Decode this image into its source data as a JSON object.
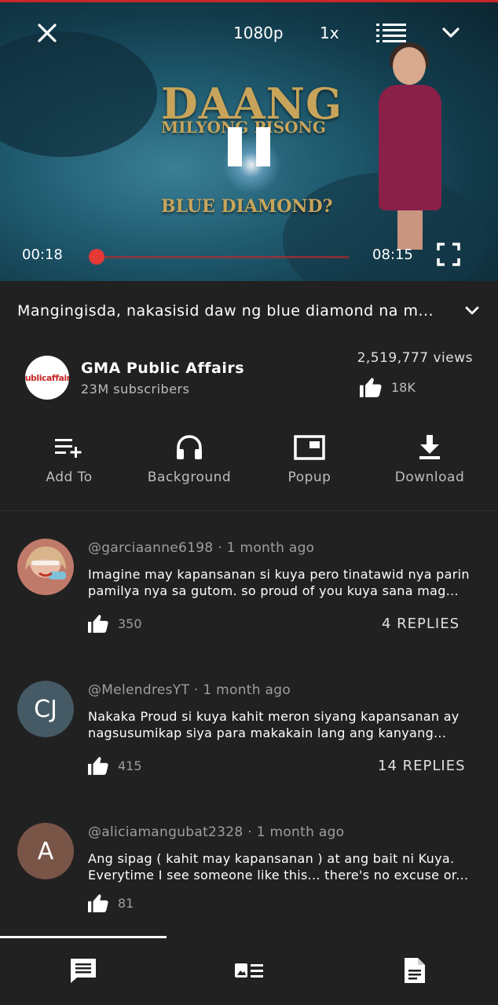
{
  "player": {
    "quality": "1080p",
    "speed": "1x",
    "current_time": "00:18",
    "duration": "08:15",
    "progress": 0.036,
    "overlay_title": "DAANG",
    "overlay_subtitle": "MILYONG PISONG",
    "overlay_bottom": "BLUE DIAMOND?"
  },
  "video": {
    "title": "Mangingisda, nakasisid daw ng blue diamond na m...",
    "views": "2,519,777 views",
    "likes": "18K"
  },
  "channel": {
    "name": "GMA Public  Affairs",
    "subscribers": "23M subscribers",
    "logo_text": "publicaffairs"
  },
  "actions": {
    "add_to": "Add To",
    "background": "Background",
    "popup": "Popup",
    "download": "Download"
  },
  "comments": [
    {
      "author": "@garciaanne6198",
      "time": "1 month ago",
      "line1": "Imagine may kapansanan si kuya pero tinatawid nya parin",
      "line2": "pamilya nya sa gutom. so proud of you kuya sana mag...",
      "likes": "350",
      "replies": "4 REPLIES",
      "avatar_text": "",
      "avatar_color": "#c9a08a"
    },
    {
      "author": "@MelendresYT",
      "time": "1 month ago",
      "line1": "Nakaka Proud si kuya kahit meron siyang kapansanan ay",
      "line2": "nagsusumikap siya para makakain lang ang kanyang...",
      "likes": "415",
      "replies": "14 REPLIES",
      "avatar_text": "CJ",
      "avatar_color": "#455a64"
    },
    {
      "author": "@aliciamangubat2328",
      "time": "1 month ago",
      "line1": "Ang sipag ( kahit may kapansanan )  at ang  bait ni Kuya.",
      "line2": "Everytime I see someone like this... there's no excuse or...",
      "likes": "81",
      "replies": "",
      "avatar_text": "A",
      "avatar_color": "#795548"
    }
  ],
  "colors": {
    "background": "#212121",
    "accent": "#e53935"
  }
}
